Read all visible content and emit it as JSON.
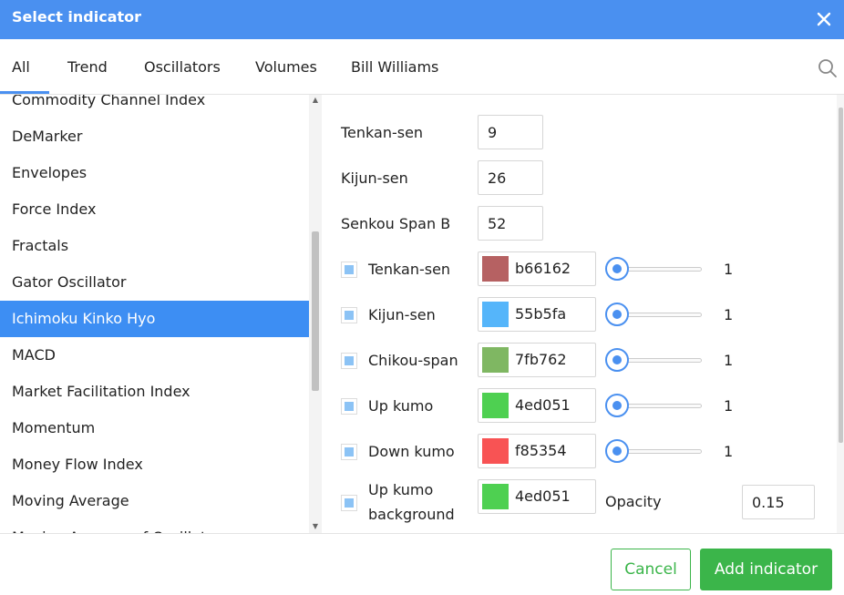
{
  "dialog": {
    "title": "Select indicator"
  },
  "tabs": [
    {
      "label": "All",
      "active": true
    },
    {
      "label": "Trend"
    },
    {
      "label": "Oscillators"
    },
    {
      "label": "Volumes"
    },
    {
      "label": "Bill Williams"
    }
  ],
  "indicators": [
    "Commodity Channel Index",
    "DeMarker",
    "Envelopes",
    "Force Index",
    "Fractals",
    "Gator Oscillator",
    "Ichimoku Kinko Hyo",
    "MACD",
    "Market Facilitation Index",
    "Momentum",
    "Money Flow Index",
    "Moving Average",
    "Moving Average of Oscillator"
  ],
  "selected_indicator": "Ichimoku Kinko Hyo",
  "params": [
    {
      "label": "Tenkan-sen",
      "value": "9"
    },
    {
      "label": "Kijun-sen",
      "value": "26"
    },
    {
      "label": "Senkou Span B",
      "value": "52"
    }
  ],
  "lines": [
    {
      "label": "Tenkan-sen",
      "color": "#b66162",
      "hex": "b66162",
      "width": "1"
    },
    {
      "label": "Kijun-sen",
      "color": "#55b5fa",
      "hex": "55b5fa",
      "width": "1"
    },
    {
      "label": "Chikou-span",
      "color": "#7fb762",
      "hex": "7fb762",
      "width": "1"
    },
    {
      "label": "Up kumo",
      "color": "#4ed051",
      "hex": "4ed051",
      "width": "1"
    },
    {
      "label": "Down kumo",
      "color": "#f85354",
      "hex": "f85354",
      "width": "1"
    }
  ],
  "background": {
    "label_line1": "Up kumo",
    "label_line2": "background",
    "color": "#4ed051",
    "hex": "4ed051",
    "opacity_label": "Opacity",
    "opacity_value": "0.15"
  },
  "footer": {
    "cancel_label": "Cancel",
    "add_label": "Add indicator"
  },
  "colors": {
    "accent": "#4a90f0",
    "selected_row": "#3d8ef3",
    "confirm": "#3bb54a"
  }
}
